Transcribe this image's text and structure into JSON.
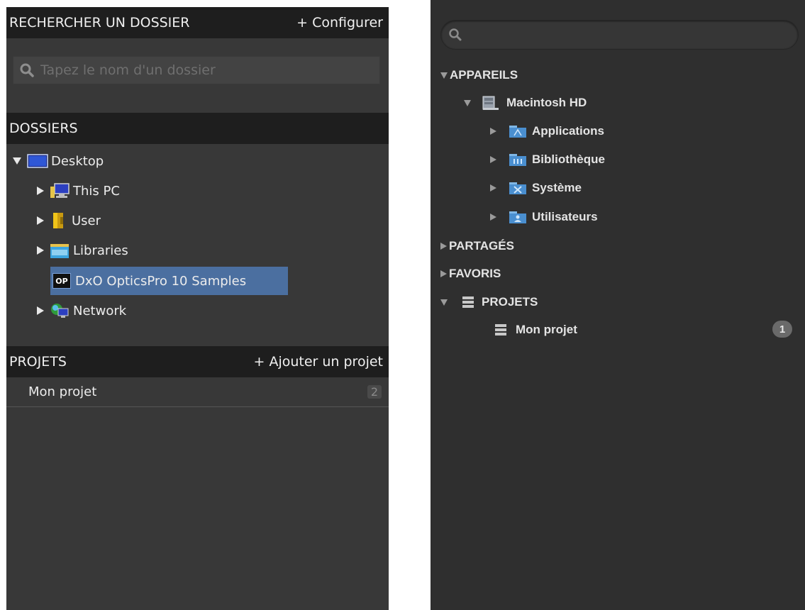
{
  "left": {
    "search_section": {
      "title": "RECHERCHER UN DOSSIER",
      "action": "+ Configurer",
      "placeholder": "Tapez le nom d'un dossier"
    },
    "folders_section": {
      "title": "DOSSIERS",
      "tree": [
        {
          "label": "Desktop",
          "icon": "desktop-icon",
          "expanded": true
        },
        {
          "label": "This PC",
          "icon": "computer-icon"
        },
        {
          "label": "User",
          "icon": "user-folder-icon"
        },
        {
          "label": "Libraries",
          "icon": "libraries-icon"
        },
        {
          "label": "DxO OpticsPro 10 Samples",
          "icon": "op-icon",
          "icon_text": "OP",
          "selected": true
        },
        {
          "label": "Network",
          "icon": "network-icon"
        }
      ]
    },
    "projects_section": {
      "title": "PROJETS",
      "action": "+ Ajouter un projet",
      "items": [
        {
          "label": "Mon projet",
          "count": "2"
        }
      ]
    }
  },
  "right": {
    "search_placeholder": "",
    "sections": {
      "devices": "APPAREILS",
      "drive": "Macintosh HD",
      "folders": [
        "Applications",
        "Bibliothèque",
        "Système",
        "Utilisateurs"
      ],
      "shared": "PARTAGÉS",
      "favorites": "FAVORIS",
      "projects": "PROJETS",
      "project_item": "Mon projet",
      "project_count": "1"
    }
  },
  "colors": {
    "left_bg": "#383838",
    "left_header_bg": "#1e1e1e",
    "selection": "#4b6fa0",
    "right_bg": "#2f2f2f"
  }
}
